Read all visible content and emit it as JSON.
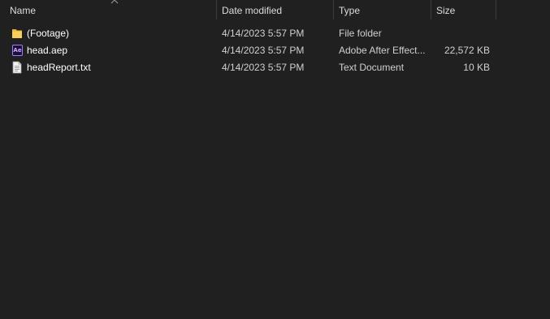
{
  "columns": {
    "name": "Name",
    "date_modified": "Date modified",
    "type": "Type",
    "size": "Size"
  },
  "sort": {
    "column": "name",
    "icon": "chevron-up-icon"
  },
  "files": [
    {
      "icon": "folder-icon",
      "name": "(Footage)",
      "date": "4/14/2023 5:57 PM",
      "type": "File folder",
      "size": ""
    },
    {
      "icon": "after-effects-file-icon",
      "icon_text": "Ae",
      "name": "head.aep",
      "date": "4/14/2023 5:57 PM",
      "type": "Adobe After Effect...",
      "size": "22,572 KB"
    },
    {
      "icon": "text-document-icon",
      "name": "headReport.txt",
      "date": "4/14/2023 5:57 PM",
      "type": "Text Document",
      "size": "10 KB"
    }
  ],
  "colors": {
    "background": "#202020",
    "folder": "#f4c542",
    "after_effects_accent": "#a27cff"
  }
}
